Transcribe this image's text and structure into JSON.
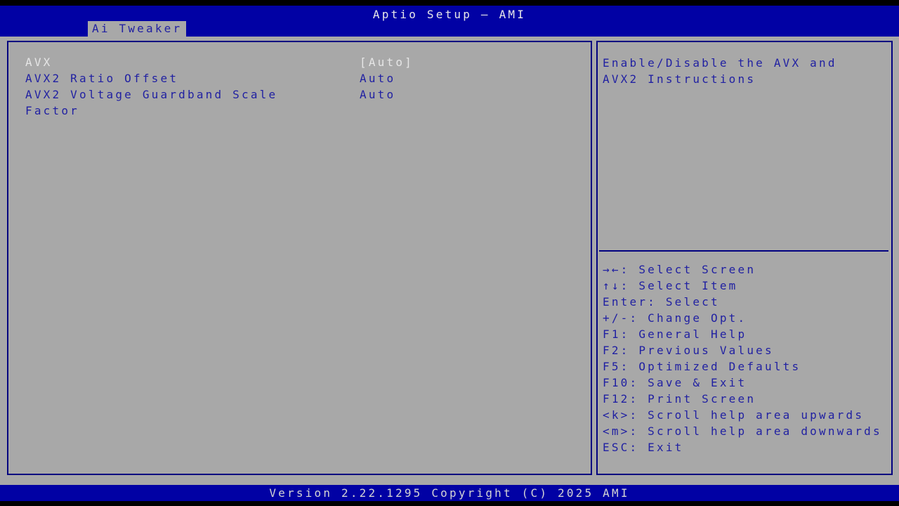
{
  "title_bar": {
    "title": "Aptio Setup – AMI"
  },
  "tab": {
    "label": "Ai Tweaker"
  },
  "settings": [
    {
      "label": "AVX",
      "value": "[Auto]",
      "selected": true
    },
    {
      "label": "AVX2 Ratio Offset",
      "value": "Auto",
      "selected": false
    },
    {
      "label_line1": "AVX2 Voltage Guardband Scale",
      "label_line2": "Factor",
      "value": "Auto",
      "selected": false
    }
  ],
  "help": {
    "lines": [
      "Enable/Disable the AVX and",
      "AVX2 Instructions"
    ]
  },
  "legend": [
    "→←: Select Screen",
    "↑↓: Select Item",
    "Enter: Select",
    "+/-: Change Opt.",
    "F1: General Help",
    "F2: Previous Values",
    "F5: Optimized Defaults",
    "F10: Save & Exit",
    "F12: Print Screen",
    "<k>: Scroll help area upwards",
    "<m>: Scroll help area downwards",
    "ESC: Exit"
  ],
  "footer": {
    "version_text": "Version 2.22.1295 Copyright (C) 2025 AMI"
  },
  "colors": {
    "bar_blue": "#0101a4",
    "border_blue": "#020280",
    "text_blue": "#2121a2",
    "background_gray": "#a8a8a8",
    "selected_text": "#e6e6e6",
    "black": "#000000"
  }
}
